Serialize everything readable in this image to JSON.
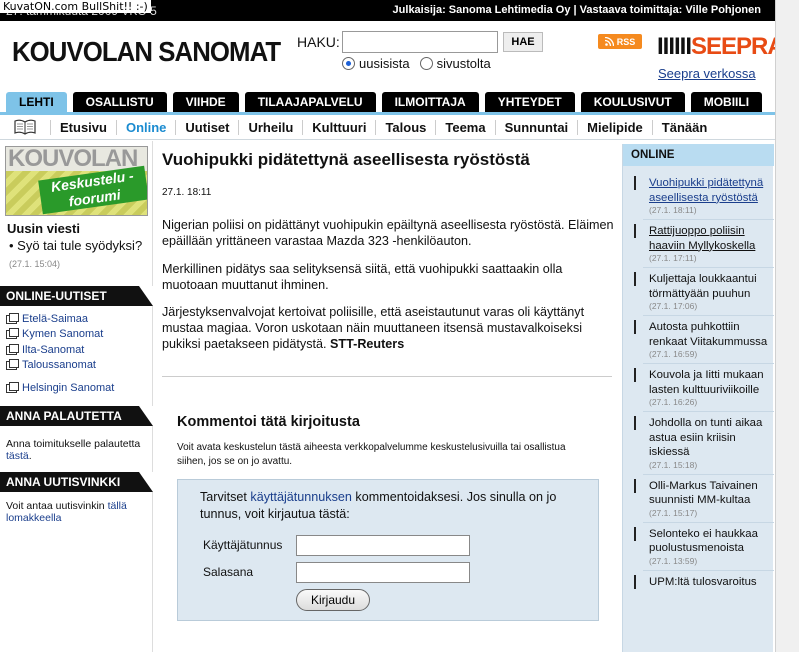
{
  "watermark": "KuvatON.com BullShit!! :-)",
  "topbar": {
    "date": "27. tammikuuta 2009 VKO 5",
    "publisher": "Julkaisija: Sanoma Lehtimedia Oy | Vastaava toimittaja: Ville Pohjonen"
  },
  "header": {
    "logo": "KOUVOLAN SANOMAT",
    "search_label": "HAKU:",
    "search_value": "",
    "search_button": "HAE",
    "radio_site": "uusisista",
    "radio_web": "sivustolta",
    "rss_label": "RSS",
    "seepra_logo_bars": "IIIIII",
    "seepra_logo_text": "SEEPRA",
    "seepra_link": "Seepra verkossa"
  },
  "tabs": [
    "LEHTI",
    "OSALLISTU",
    "VIIHDE",
    "TILAAJAPALVELU",
    "ILMOITTAJA",
    "YHTEYDET",
    "KOULUSIVUT",
    "MOBIILI"
  ],
  "subnav": [
    "Etusivu",
    "Online",
    "Uutiset",
    "Urheilu",
    "Kulttuuri",
    "Talous",
    "Teema",
    "Sunnuntai",
    "Mielipide",
    "Tänään"
  ],
  "left": {
    "forum_banner_big": "KOUVOLAN S",
    "forum_banner_text": "Keskustelu -foorumi",
    "uusin_title": "Uusin viesti",
    "uusin_text": "Syö tai tule syödyksi?",
    "uusin_time": "(27.1. 15:04)",
    "online_uutiset_hdr": "ONLINE-UUTISET",
    "online_links": [
      "Etelä-Saimaa",
      "Kymen Sanomat",
      "Ilta-Sanomat",
      "Taloussanomat"
    ],
    "hs_link": "Helsingin Sanomat",
    "palaute_hdr": "ANNA PALAUTETTA",
    "palaute_text": "Anna toimitukselle palautetta ",
    "palaute_link": "tästä",
    "palaute_end": ".",
    "vinkki_hdr": "ANNA UUTISVINKKI",
    "vinkki_text": "Voit antaa uutisvinkin ",
    "vinkki_link": "tällä lomakkeella"
  },
  "article": {
    "title": "Vuohipukki pidätettynä aseellisesta ryöstöstä",
    "date": "27.1. 18:11",
    "p1": "Nigerian poliisi on pidättänyt vuohipukin epäiltynä aseellisesta ryöstöstä. Eläimen epäillään yrittäneen varastaa Mazda 323 -henkilöauton.",
    "p2": "Merkillinen pidätys saa selityksensä siitä, että vuohipukki saattaakin olla muotoaan muuttanut ihminen.",
    "p3": "Järjestyksenvalvojat kertoivat poliisille, että aseistautunut varas oli käyttänyt mustaa magiaa. Voron uskotaan näin muuttaneen itsensä mustavalkoiseksi pukiksi paetakseen pidätystä. ",
    "p3_source": "STT-Reuters"
  },
  "comment": {
    "title": "Kommentoi tätä kirjoitusta",
    "desc": "Voit avata keskustelun tästä aiheesta verkkopalvelumme keskustelusivuilla tai osallistua siihen, jos se on jo avattu.",
    "intro_a": "Tarvitset ",
    "intro_link": "käyttäjätunnuksen",
    "intro_b": " kommentoidaksesi. Jos sinulla on jo tunnus, voit kirjautua tästä:",
    "username_label": "Käyttäjätunnus",
    "username_value": "",
    "password_label": "Salasana",
    "password_value": "",
    "login_button": "Kirjaudu"
  },
  "right": {
    "header": "ONLINE",
    "items": [
      {
        "headline": "Vuohipukki pidätettynä aseellisesta ryöstöstä",
        "time": "(27.1. 18:11)"
      },
      {
        "headline": "Rattijuoppo poliisin haaviin Myllykoskella",
        "time": "(27.1. 17:11)"
      },
      {
        "headline": "Kuljettaja loukkaantui törmättyään puuhun",
        "time": "(27.1. 17:06)"
      },
      {
        "headline": "Autosta puhkottiin renkaat Viitakummussa",
        "time": "(27.1. 16:59)"
      },
      {
        "headline": "Kouvola ja Iitti mukaan lasten kulttuuriviikoille",
        "time": "(27.1. 16:26)"
      },
      {
        "headline": "Johdolla on tunti aikaa astua esiin kriisin iskiessä",
        "time": "(27.1. 15:18)"
      },
      {
        "headline": "Olli-Markus Taivainen suunnisti MM-kultaa",
        "time": "(27.1. 15:17)"
      },
      {
        "headline": "Selonteko ei haukkaa puolustusmenoista",
        "time": "(27.1. 13:59)"
      },
      {
        "headline": "UPM:ltä tulosvaroitus",
        "time": ""
      }
    ]
  }
}
